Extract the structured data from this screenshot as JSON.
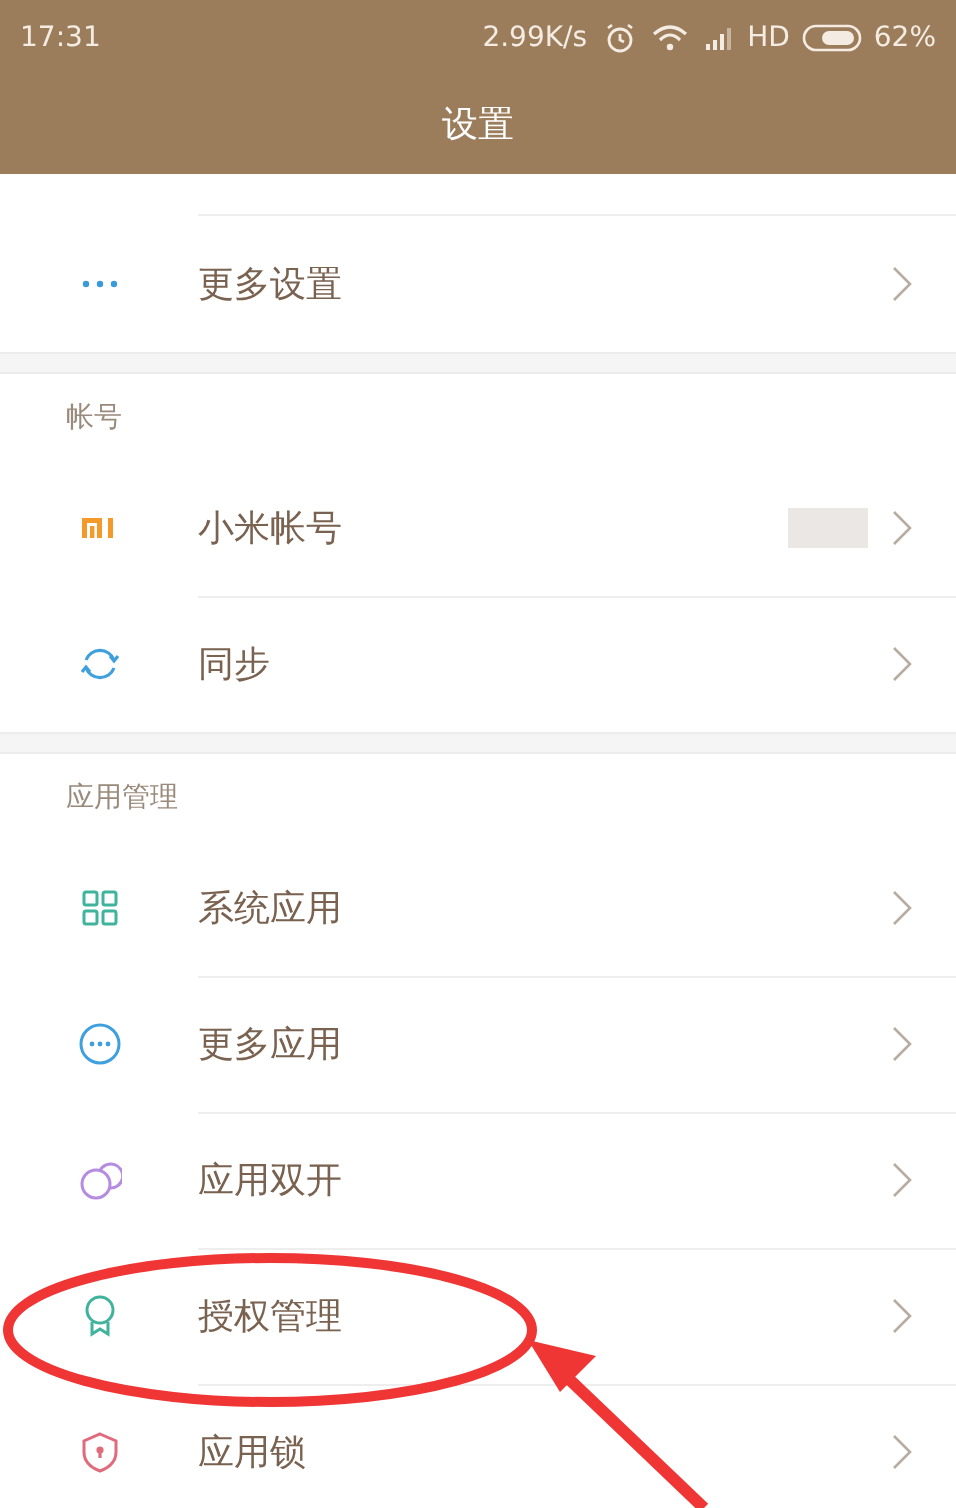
{
  "status_bar": {
    "time": "17:31",
    "speed": "2.99K/s",
    "network": "HD",
    "battery": "62%"
  },
  "title": "设置",
  "sections": [
    {
      "items": [
        {
          "label": "更多设置",
          "kind": "dots"
        }
      ]
    },
    {
      "header": "帐号",
      "items": [
        {
          "label": "小米帐号",
          "kind": "mi",
          "redacted": true
        },
        {
          "label": "同步",
          "kind": "sync"
        }
      ]
    },
    {
      "header": "应用管理",
      "items": [
        {
          "label": "系统应用",
          "kind": "grid"
        },
        {
          "label": "更多应用",
          "kind": "more"
        },
        {
          "label": "应用双开",
          "kind": "dual"
        },
        {
          "label": "授权管理",
          "kind": "award"
        },
        {
          "label": "应用锁",
          "kind": "lock"
        }
      ]
    }
  ],
  "annotation": {
    "kind": "ellipse-arrow"
  }
}
